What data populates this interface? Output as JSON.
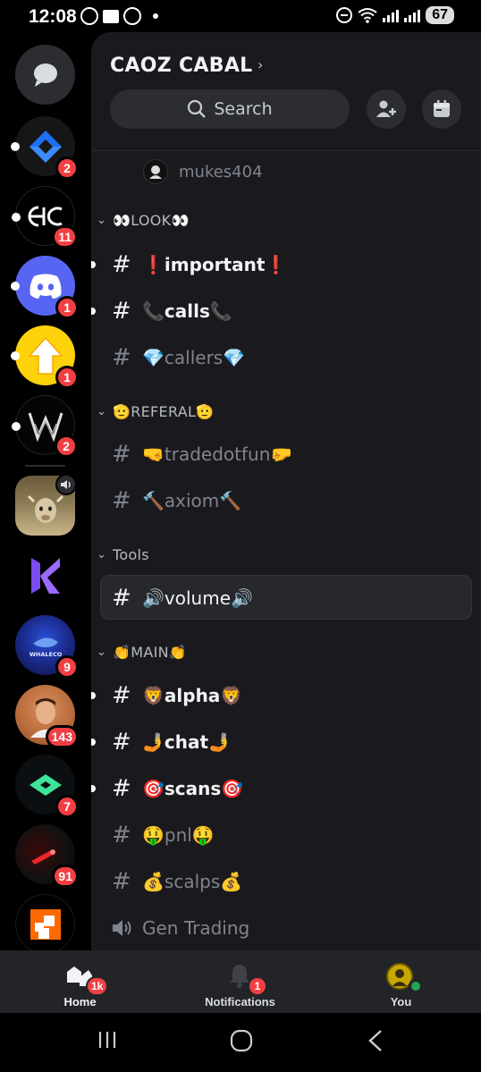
{
  "status_bar": {
    "time": "12:08",
    "battery": "67"
  },
  "server": {
    "name": "CAOZ CABAL"
  },
  "search": {
    "label": "Search"
  },
  "user_row": {
    "name": "mukes404"
  },
  "servers": [
    {
      "name": "direct-messages",
      "badge": ""
    },
    {
      "name": "server-blue-arrows",
      "badge": "2"
    },
    {
      "name": "server-ac",
      "badge": "11"
    },
    {
      "name": "server-discord",
      "badge": "1"
    },
    {
      "name": "server-yellow-arrow",
      "badge": "1"
    },
    {
      "name": "server-w",
      "badge": "2"
    },
    {
      "name": "server-goat",
      "badge": ""
    },
    {
      "name": "server-k",
      "badge": ""
    },
    {
      "name": "server-whale",
      "badge": "9",
      "logo_text": "WHALECO"
    },
    {
      "name": "server-person",
      "badge": "143"
    },
    {
      "name": "server-green-diamond",
      "badge": "7"
    },
    {
      "name": "server-red-light",
      "badge": "91"
    },
    {
      "name": "server-orange-square",
      "badge": ""
    }
  ],
  "categories": {
    "look": "👀LOOK👀",
    "referal": "🫡REFERAL🫡",
    "tools": "Tools",
    "main": "👏MAIN👏"
  },
  "channels": {
    "important": "❗important❗",
    "calls": "📞calls📞",
    "callers": "💎callers💎",
    "tradedotfun": "🤜tradedotfun🤛",
    "axiom": "🔨axiom🔨",
    "volume": "🔊volume🔊",
    "alpha": "🦁alpha🦁",
    "chat": "🤳chat🤳",
    "scans": "🎯scans🎯",
    "pnl": "🤑pnl🤑",
    "scalps": "💰scalps💰",
    "gen_trading": "Gen Trading"
  },
  "hash_symbol": "#",
  "bottom_nav": {
    "home": "Home",
    "home_badge": "1k",
    "notifications": "Notifications",
    "notifications_badge": "1",
    "you": "You"
  },
  "colors": {
    "accent": "#5865f2",
    "badge": "#f23f43",
    "panel": "#1a1a1e"
  }
}
